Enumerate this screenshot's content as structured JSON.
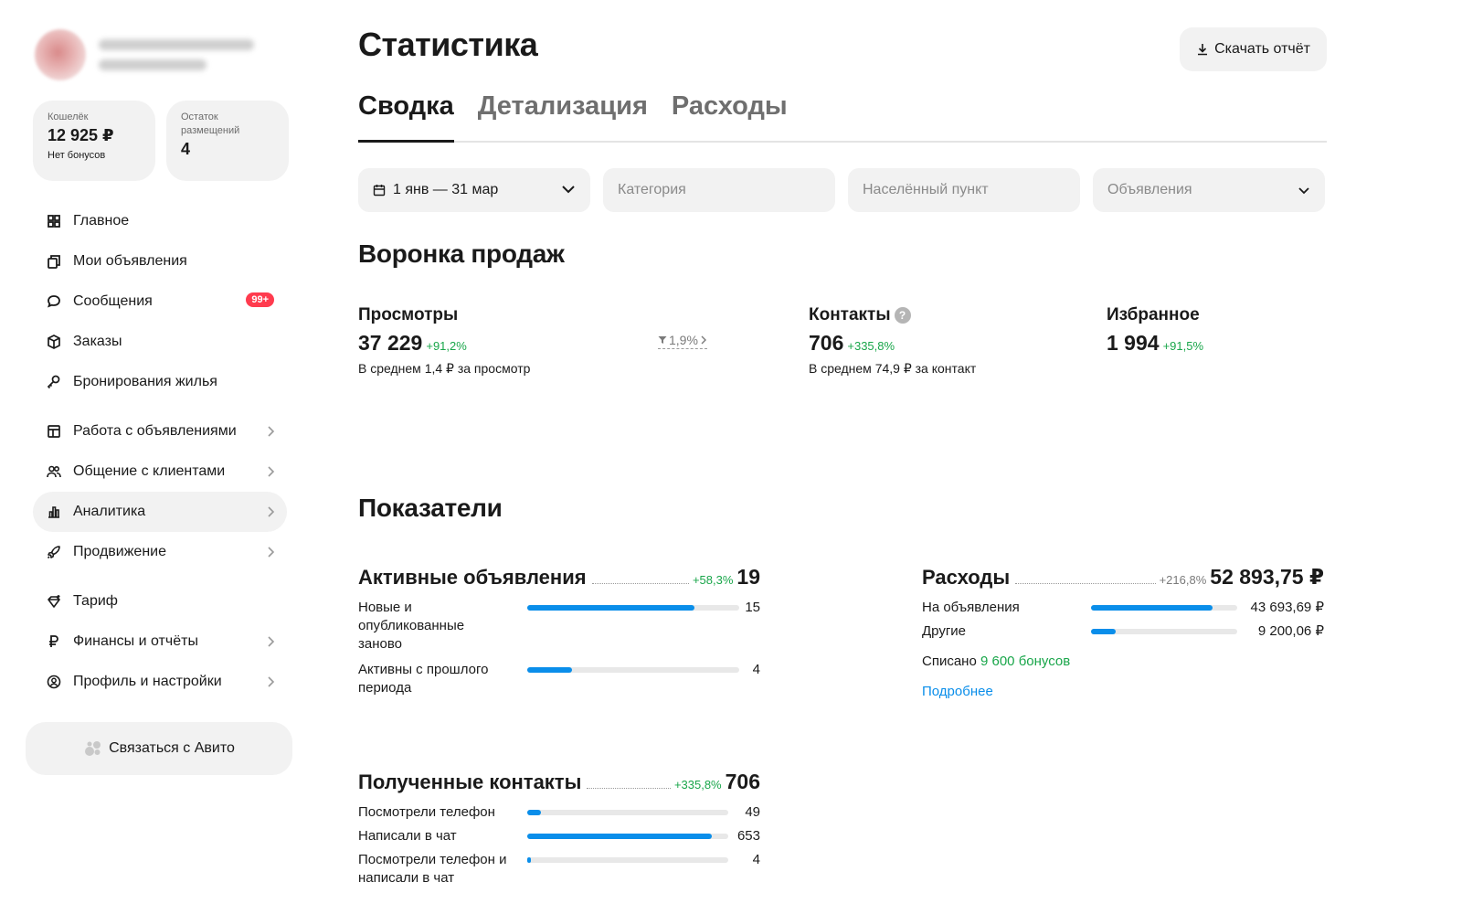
{
  "sidebar": {
    "wallet": {
      "label": "Кошелёк",
      "value": "12 925 ₽",
      "sub": "Нет бонусов"
    },
    "placements": {
      "label": "Остаток размещений",
      "value": "4"
    },
    "nav": [
      {
        "label": "Главное",
        "icon": "grid-icon"
      },
      {
        "label": "Мои объявления",
        "icon": "copy-icon"
      },
      {
        "label": "Сообщения",
        "icon": "chat-icon",
        "badge": "99+"
      },
      {
        "label": "Заказы",
        "icon": "box-icon"
      },
      {
        "label": "Бронирования жилья",
        "icon": "key-icon"
      },
      {
        "label": "Работа с объявлениями",
        "icon": "board-icon",
        "chevron": true
      },
      {
        "label": "Общение с клиентами",
        "icon": "users-icon",
        "chevron": true
      },
      {
        "label": "Аналитика",
        "icon": "chart-icon",
        "chevron": true,
        "active": true
      },
      {
        "label": "Продвижение",
        "icon": "rocket-icon",
        "chevron": true
      },
      {
        "label": "Тариф",
        "icon": "diamond-icon"
      },
      {
        "label": "Финансы и отчёты",
        "icon": "ruble-icon",
        "chevron": true
      },
      {
        "label": "Профиль и настройки",
        "icon": "profile-icon",
        "chevron": true
      }
    ],
    "contact_button": "Связаться с Авито"
  },
  "main": {
    "title": "Статистика",
    "download_button": "Скачать отчёт",
    "tabs": [
      "Сводка",
      "Детализация",
      "Расходы"
    ],
    "active_tab": 0,
    "filters": {
      "date": "1 янв — 31 мар",
      "category_placeholder": "Категория",
      "city_placeholder": "Населённый пункт",
      "ads_placeholder": "Объявления"
    },
    "funnel": {
      "title": "Воронка продаж",
      "views": {
        "label": "Просмотры",
        "value": "37 229",
        "delta": "+91,2%",
        "sub": "В среднем 1,4 ₽ за просмотр"
      },
      "conversion": "1,9%",
      "contacts": {
        "label": "Контакты",
        "value": "706",
        "delta": "+335,8%",
        "sub": "В среднем 74,9 ₽ за контакт"
      },
      "favorites": {
        "label": "Избранное",
        "value": "1 994",
        "delta": "+91,5%"
      }
    },
    "metrics": {
      "title": "Показатели",
      "active_ads": {
        "title": "Активные объявления",
        "delta": "+58,3%",
        "total": "19",
        "rows": [
          {
            "label": "Новые и опубликованные заново",
            "value": "15",
            "fill": 0.79
          },
          {
            "label": "Активны с прошлого периода",
            "value": "4",
            "fill": 0.21
          }
        ]
      },
      "expenses": {
        "title": "Расходы",
        "delta": "+216,8%",
        "total": "52 893,75 ₽",
        "rows": [
          {
            "label": "На объявления",
            "value": "43 693,69 ₽",
            "fill": 0.83
          },
          {
            "label": "Другие",
            "value": "9 200,06 ₽",
            "fill": 0.17
          }
        ],
        "written_off_label": "Списано",
        "written_off_value": "9 600 бонусов",
        "more_link": "Подробнее"
      },
      "contacts": {
        "title": "Полученные контакты",
        "delta": "+335,8%",
        "total": "706",
        "rows": [
          {
            "label": "Посмотрели телефон",
            "value": "49",
            "fill": 0.07
          },
          {
            "label": "Написали в чат",
            "value": "653",
            "fill": 0.92
          },
          {
            "label": "Посмотрели телефон и написали в чат",
            "value": "4",
            "fill": 0.02
          }
        ]
      }
    }
  },
  "colors": {
    "accent": "#0a8eea",
    "positive": "#19a64a",
    "badge": "#ff3b4e",
    "surface": "#f2f2f2"
  }
}
